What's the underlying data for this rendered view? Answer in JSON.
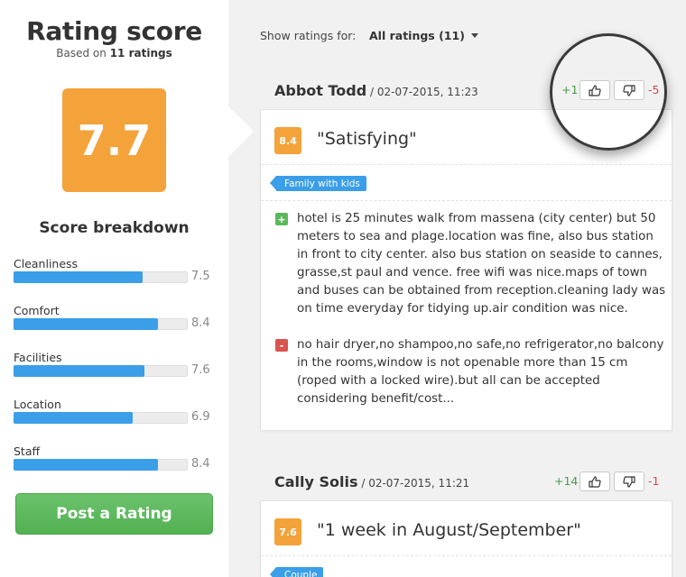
{
  "left": {
    "title": "Rating score",
    "based_prefix": "Based on",
    "based_count": "11 ratings",
    "score": "7.7",
    "breakdown_title": "Score breakdown",
    "categories": [
      {
        "label": "Cleanliness",
        "value": "7.5",
        "fraction": 0.75
      },
      {
        "label": "Comfort",
        "value": "8.4",
        "fraction": 0.84
      },
      {
        "label": "Facilities",
        "value": "7.6",
        "fraction": 0.76
      },
      {
        "label": "Location",
        "value": "6.9",
        "fraction": 0.69
      },
      {
        "label": "Staff",
        "value": "8.4",
        "fraction": 0.84
      }
    ],
    "post_button": "Post a Rating"
  },
  "filter": {
    "label": "Show ratings for:",
    "selected": "All ratings (11)"
  },
  "reviews": [
    {
      "author": "Abbot Todd",
      "date": " / 02-07-2015, 11:23",
      "plus": "+1",
      "minus": "-5",
      "score": "8.4",
      "title": "\"Satisfying\"",
      "tag": "Family with kids",
      "positive": "hotel is 25 minutes walk from massena (city center) but 50 meters to sea and plage.location was fine, also bus station in front to city center. also bus station on seaside to cannes, grasse,st paul and vence. free wifi was nice.maps of town and buses can be obtained from reception.cleaning lady was on time everyday for tidying up.air condition was nice.",
      "negative": "no hair dryer,no shampoo,no safe,no refrigerator,no balcony in the rooms,window is not openable more than 15 cm (roped with a locked wire).but all can be accepted considering benefit/cost..."
    },
    {
      "author": "Cally Solis",
      "date": " / 02-07-2015, 11:21",
      "plus": "+14",
      "minus": "-1",
      "score": "7.6",
      "title": "\"1 week in August/September\"",
      "tag": "Couple"
    }
  ],
  "colors": {
    "accent_orange": "#f4a23a",
    "bar_blue": "#3a9ee8",
    "button_green": "#5cb85c",
    "positive_green": "#5cb85c",
    "negative_red": "#d9534f"
  },
  "icons": [
    "thumbs-up-icon",
    "thumbs-down-icon",
    "plus-icon",
    "minus-icon",
    "chevron-down-icon"
  ]
}
